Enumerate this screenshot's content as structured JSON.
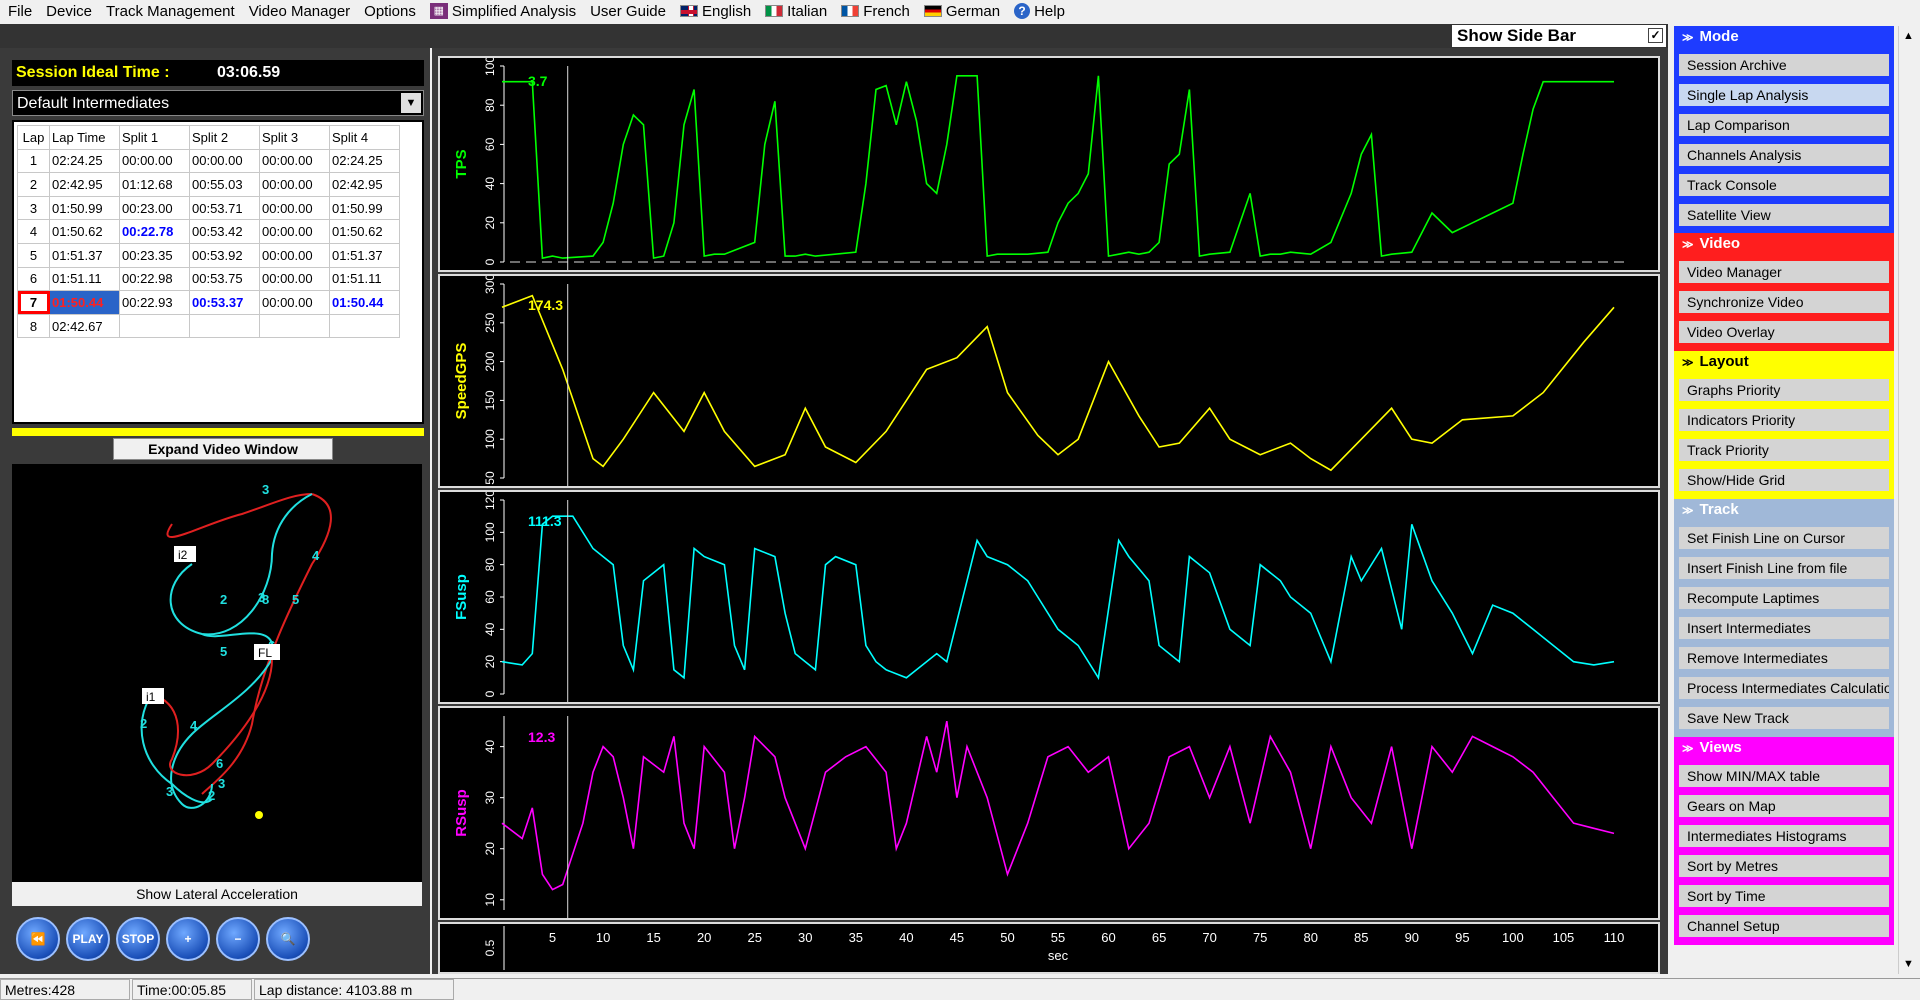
{
  "menu": {
    "items": [
      "File",
      "Device",
      "Track Management",
      "Video Manager",
      "Options"
    ],
    "simplified": "Simplified Analysis",
    "user_guide": "User Guide",
    "english": "English",
    "italian": "Italian",
    "french": "French",
    "german": "German",
    "help": "Help"
  },
  "top": {
    "show_side_bar": "Show Side Bar",
    "checked": "✓"
  },
  "session": {
    "ideal_label": "Session Ideal Time :",
    "ideal_value": "03:06.59",
    "intermediates": "Default Intermediates"
  },
  "lap_table": {
    "headers": [
      "Lap",
      "Lap Time",
      "Split 1",
      "Split 2",
      "Split 3",
      "Split 4"
    ],
    "rows": [
      [
        "1",
        "02:24.25",
        "00:00.00",
        "00:00.00",
        "00:00.00",
        "02:24.25"
      ],
      [
        "2",
        "02:42.95",
        "01:12.68",
        "00:55.03",
        "00:00.00",
        "02:42.95"
      ],
      [
        "3",
        "01:50.99",
        "00:23.00",
        "00:53.71",
        "00:00.00",
        "01:50.99"
      ],
      [
        "4",
        "01:50.62",
        "00:22.78",
        "00:53.42",
        "00:00.00",
        "01:50.62"
      ],
      [
        "5",
        "01:51.37",
        "00:23.35",
        "00:53.92",
        "00:00.00",
        "01:51.37"
      ],
      [
        "6",
        "01:51.11",
        "00:22.98",
        "00:53.75",
        "00:00.00",
        "01:51.11"
      ],
      [
        "7",
        "01:50.44",
        "00:22.93",
        "00:53.37",
        "00:00.00",
        "01:50.44"
      ],
      [
        "8",
        "02:42.67",
        "",
        "",
        "",
        ""
      ]
    ]
  },
  "video": {
    "expand": "Expand Video Window"
  },
  "map": {
    "labels": {
      "i1": "i1",
      "i2": "i2",
      "fl": "FL"
    },
    "numbers": [
      "3",
      "4",
      "5",
      "6",
      "2",
      "2",
      "3",
      "5",
      "3",
      "4",
      "6",
      "3",
      "2",
      "8"
    ]
  },
  "show_lateral": "Show Lateral Acceleration",
  "controls": {
    "rewind": "⏪",
    "play": "PLAY",
    "stop": "STOP",
    "zoom_in": "+",
    "zoom_out": "−",
    "zoom": "🔍"
  },
  "colors": {
    "tps": "#00ff00",
    "speed": "#ffff00",
    "fsusp": "#00ffff",
    "rsusp": "#ff00ff",
    "mode": "#1e3cff",
    "video": "#ff1e1e",
    "layout": "#ffff00",
    "track": "#a0b8d8",
    "views": "#ff00ff"
  },
  "chart_data": [
    {
      "type": "line",
      "ylabel": "TPS",
      "cursor_value": "3.7",
      "yticks": [
        "0",
        "20",
        "40",
        "60",
        "80",
        "100"
      ],
      "ylim": [
        0,
        100
      ],
      "x": [
        0,
        3,
        4,
        5,
        6,
        9,
        10,
        11,
        12,
        13,
        14,
        15,
        16,
        17,
        18,
        19,
        20,
        21,
        22,
        25,
        26,
        27,
        28,
        29,
        30,
        31,
        35,
        36,
        37,
        38,
        39,
        40,
        41,
        42,
        43,
        44,
        45,
        46,
        47,
        48,
        49,
        52,
        54,
        55,
        56,
        57,
        58,
        59,
        60,
        61,
        62,
        63,
        64,
        65,
        66,
        67,
        68,
        69,
        70,
        72,
        73,
        74,
        75,
        76,
        77,
        78,
        80,
        82,
        84,
        85,
        86,
        87,
        88,
        90,
        92,
        94,
        96,
        98,
        100,
        101,
        102,
        103,
        104,
        105,
        106,
        108,
        110
      ],
      "values": [
        92,
        92,
        2,
        3,
        2,
        3,
        10,
        30,
        60,
        75,
        70,
        2,
        3,
        20,
        70,
        88,
        3,
        4,
        4,
        10,
        60,
        82,
        3,
        3,
        4,
        3,
        5,
        40,
        88,
        90,
        70,
        92,
        72,
        40,
        35,
        60,
        95,
        95,
        95,
        3,
        4,
        4,
        5,
        20,
        30,
        35,
        45,
        95,
        3,
        4,
        5,
        4,
        5,
        10,
        50,
        55,
        88,
        3,
        4,
        5,
        20,
        35,
        3,
        4,
        4,
        5,
        4,
        10,
        35,
        55,
        65,
        3,
        4,
        5,
        25,
        15,
        20,
        25,
        30,
        55,
        78,
        92,
        92,
        92,
        92,
        92,
        92
      ],
      "xlim": [
        0,
        110
      ]
    },
    {
      "type": "line",
      "ylabel": "SpeedGPS",
      "cursor_value": "174.3",
      "yticks": [
        "50",
        "100",
        "150",
        "200",
        "250",
        "300"
      ],
      "ylim": [
        50,
        300
      ],
      "x": [
        0,
        3,
        6,
        9,
        10,
        12,
        15,
        18,
        20,
        22,
        25,
        28,
        30,
        32,
        35,
        38,
        40,
        42,
        45,
        48,
        50,
        53,
        55,
        57,
        60,
        63,
        65,
        67,
        70,
        72,
        75,
        78,
        80,
        82,
        85,
        88,
        90,
        92,
        95,
        100,
        103,
        107,
        110
      ],
      "values": [
        270,
        285,
        190,
        75,
        65,
        100,
        160,
        110,
        160,
        110,
        65,
        80,
        140,
        90,
        70,
        110,
        150,
        190,
        205,
        245,
        160,
        105,
        80,
        100,
        200,
        130,
        90,
        95,
        140,
        100,
        80,
        95,
        75,
        60,
        100,
        140,
        100,
        95,
        125,
        130,
        160,
        225,
        270
      ],
      "xlim": [
        0,
        110
      ]
    },
    {
      "type": "line",
      "ylabel": "FSusp",
      "cursor_value": "111.3",
      "yticks": [
        "0",
        "20",
        "40",
        "60",
        "80",
        "100",
        "120"
      ],
      "ylim": [
        0,
        120
      ],
      "x": [
        0,
        2,
        3,
        4,
        5,
        7,
        9,
        10,
        11,
        12,
        13,
        14,
        15,
        16,
        17,
        18,
        19,
        20,
        22,
        23,
        24,
        25,
        27,
        28,
        29,
        30,
        31,
        32,
        33,
        35,
        36,
        37,
        38,
        40,
        41,
        43,
        44,
        47,
        48,
        50,
        52,
        53,
        55,
        57,
        59,
        61,
        62,
        64,
        65,
        67,
        68,
        70,
        72,
        74,
        75,
        77,
        78,
        80,
        82,
        84,
        85,
        87,
        89,
        90,
        92,
        94,
        96,
        98,
        100,
        102,
        104,
        106,
        108,
        110
      ],
      "values": [
        20,
        18,
        25,
        105,
        110,
        110,
        90,
        85,
        80,
        30,
        15,
        70,
        75,
        80,
        15,
        10,
        90,
        85,
        80,
        30,
        15,
        90,
        85,
        50,
        25,
        20,
        15,
        80,
        85,
        80,
        30,
        20,
        15,
        10,
        15,
        25,
        20,
        95,
        85,
        80,
        70,
        60,
        40,
        30,
        10,
        95,
        85,
        70,
        30,
        20,
        85,
        75,
        40,
        30,
        80,
        70,
        60,
        50,
        20,
        85,
        70,
        90,
        40,
        105,
        70,
        50,
        25,
        55,
        50,
        40,
        30,
        20,
        18,
        20
      ],
      "xlim": [
        0,
        110
      ]
    },
    {
      "type": "line",
      "ylabel": "RSusp",
      "cursor_value": "12.3",
      "yticks": [
        "10",
        "20",
        "30",
        "40"
      ],
      "ylim": [
        8,
        46
      ],
      "x": [
        0,
        2,
        3,
        4,
        5,
        6,
        8,
        9,
        10,
        11,
        12,
        13,
        14,
        16,
        17,
        18,
        19,
        20,
        22,
        23,
        24,
        25,
        27,
        28,
        30,
        32,
        34,
        36,
        38,
        39,
        40,
        42,
        43,
        44,
        45,
        46,
        47,
        48,
        50,
        52,
        54,
        56,
        58,
        60,
        62,
        64,
        66,
        68,
        70,
        72,
        74,
        76,
        78,
        80,
        82,
        84,
        86,
        88,
        90,
        92,
        94,
        96,
        98,
        100,
        102,
        104,
        106,
        108,
        110
      ],
      "values": [
        25,
        22,
        28,
        15,
        12,
        13,
        25,
        35,
        40,
        38,
        30,
        20,
        38,
        35,
        42,
        25,
        20,
        40,
        35,
        20,
        30,
        42,
        38,
        30,
        20,
        35,
        38,
        40,
        35,
        20,
        25,
        42,
        35,
        45,
        30,
        40,
        35,
        30,
        15,
        25,
        38,
        40,
        35,
        38,
        20,
        25,
        38,
        40,
        30,
        40,
        25,
        42,
        35,
        20,
        40,
        30,
        25,
        40,
        20,
        40,
        35,
        42,
        40,
        38,
        35,
        30,
        25,
        24,
        23
      ],
      "xlim": [
        0,
        110
      ]
    },
    {
      "type": "line",
      "xlabel": "sec",
      "xticks": [
        "5",
        "10",
        "15",
        "20",
        "25",
        "30",
        "35",
        "40",
        "45",
        "50",
        "55",
        "60",
        "65",
        "70",
        "75",
        "80",
        "85",
        "90",
        "95",
        "100",
        "105",
        "110"
      ],
      "ytick": "0.5"
    }
  ],
  "sidebar": {
    "mode": {
      "title": "Mode",
      "items": [
        "Session Archive",
        "Single Lap Analysis",
        "Lap Comparison",
        "Channels Analysis",
        "Track Console",
        "Satellite View"
      ]
    },
    "video": {
      "title": "Video",
      "items": [
        "Video Manager",
        "Synchronize Video",
        "Video Overlay"
      ]
    },
    "layout": {
      "title": "Layout",
      "items": [
        "Graphs Priority",
        "Indicators Priority",
        "Track Priority",
        "Show/Hide Grid"
      ]
    },
    "track": {
      "title": "Track",
      "items": [
        "Set Finish Line on Cursor",
        "Insert Finish Line from file",
        "Recompute Laptimes",
        "Insert Intermediates",
        "Remove Intermediates",
        "Process Intermediates Calculation",
        "Save New Track"
      ]
    },
    "views": {
      "title": "Views",
      "items": [
        "Show MIN/MAX table",
        "Gears on Map",
        "Intermediates Histograms",
        "Sort by Metres",
        "Sort by Time",
        "Channel Setup"
      ]
    }
  },
  "status": {
    "metres": "Metres:428",
    "time": "Time:00:05.85",
    "lap_distance": "Lap distance: 4103.88 m"
  }
}
